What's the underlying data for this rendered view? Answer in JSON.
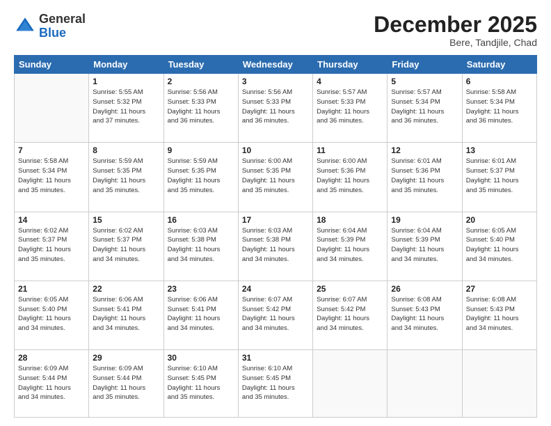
{
  "header": {
    "logo": {
      "general": "General",
      "blue": "Blue"
    },
    "title": "December 2025",
    "location": "Bere, Tandjile, Chad"
  },
  "weekdays": [
    "Sunday",
    "Monday",
    "Tuesday",
    "Wednesday",
    "Thursday",
    "Friday",
    "Saturday"
  ],
  "weeks": [
    [
      {
        "day": null,
        "data": null
      },
      {
        "day": "1",
        "data": "Sunrise: 5:55 AM\nSunset: 5:32 PM\nDaylight: 11 hours\nand 37 minutes."
      },
      {
        "day": "2",
        "data": "Sunrise: 5:56 AM\nSunset: 5:33 PM\nDaylight: 11 hours\nand 36 minutes."
      },
      {
        "day": "3",
        "data": "Sunrise: 5:56 AM\nSunset: 5:33 PM\nDaylight: 11 hours\nand 36 minutes."
      },
      {
        "day": "4",
        "data": "Sunrise: 5:57 AM\nSunset: 5:33 PM\nDaylight: 11 hours\nand 36 minutes."
      },
      {
        "day": "5",
        "data": "Sunrise: 5:57 AM\nSunset: 5:34 PM\nDaylight: 11 hours\nand 36 minutes."
      },
      {
        "day": "6",
        "data": "Sunrise: 5:58 AM\nSunset: 5:34 PM\nDaylight: 11 hours\nand 36 minutes."
      }
    ],
    [
      {
        "day": "7",
        "data": "Sunrise: 5:58 AM\nSunset: 5:34 PM\nDaylight: 11 hours\nand 35 minutes."
      },
      {
        "day": "8",
        "data": "Sunrise: 5:59 AM\nSunset: 5:35 PM\nDaylight: 11 hours\nand 35 minutes."
      },
      {
        "day": "9",
        "data": "Sunrise: 5:59 AM\nSunset: 5:35 PM\nDaylight: 11 hours\nand 35 minutes."
      },
      {
        "day": "10",
        "data": "Sunrise: 6:00 AM\nSunset: 5:35 PM\nDaylight: 11 hours\nand 35 minutes."
      },
      {
        "day": "11",
        "data": "Sunrise: 6:00 AM\nSunset: 5:36 PM\nDaylight: 11 hours\nand 35 minutes."
      },
      {
        "day": "12",
        "data": "Sunrise: 6:01 AM\nSunset: 5:36 PM\nDaylight: 11 hours\nand 35 minutes."
      },
      {
        "day": "13",
        "data": "Sunrise: 6:01 AM\nSunset: 5:37 PM\nDaylight: 11 hours\nand 35 minutes."
      }
    ],
    [
      {
        "day": "14",
        "data": "Sunrise: 6:02 AM\nSunset: 5:37 PM\nDaylight: 11 hours\nand 35 minutes."
      },
      {
        "day": "15",
        "data": "Sunrise: 6:02 AM\nSunset: 5:37 PM\nDaylight: 11 hours\nand 34 minutes."
      },
      {
        "day": "16",
        "data": "Sunrise: 6:03 AM\nSunset: 5:38 PM\nDaylight: 11 hours\nand 34 minutes."
      },
      {
        "day": "17",
        "data": "Sunrise: 6:03 AM\nSunset: 5:38 PM\nDaylight: 11 hours\nand 34 minutes."
      },
      {
        "day": "18",
        "data": "Sunrise: 6:04 AM\nSunset: 5:39 PM\nDaylight: 11 hours\nand 34 minutes."
      },
      {
        "day": "19",
        "data": "Sunrise: 6:04 AM\nSunset: 5:39 PM\nDaylight: 11 hours\nand 34 minutes."
      },
      {
        "day": "20",
        "data": "Sunrise: 6:05 AM\nSunset: 5:40 PM\nDaylight: 11 hours\nand 34 minutes."
      }
    ],
    [
      {
        "day": "21",
        "data": "Sunrise: 6:05 AM\nSunset: 5:40 PM\nDaylight: 11 hours\nand 34 minutes."
      },
      {
        "day": "22",
        "data": "Sunrise: 6:06 AM\nSunset: 5:41 PM\nDaylight: 11 hours\nand 34 minutes."
      },
      {
        "day": "23",
        "data": "Sunrise: 6:06 AM\nSunset: 5:41 PM\nDaylight: 11 hours\nand 34 minutes."
      },
      {
        "day": "24",
        "data": "Sunrise: 6:07 AM\nSunset: 5:42 PM\nDaylight: 11 hours\nand 34 minutes."
      },
      {
        "day": "25",
        "data": "Sunrise: 6:07 AM\nSunset: 5:42 PM\nDaylight: 11 hours\nand 34 minutes."
      },
      {
        "day": "26",
        "data": "Sunrise: 6:08 AM\nSunset: 5:43 PM\nDaylight: 11 hours\nand 34 minutes."
      },
      {
        "day": "27",
        "data": "Sunrise: 6:08 AM\nSunset: 5:43 PM\nDaylight: 11 hours\nand 34 minutes."
      }
    ],
    [
      {
        "day": "28",
        "data": "Sunrise: 6:09 AM\nSunset: 5:44 PM\nDaylight: 11 hours\nand 34 minutes."
      },
      {
        "day": "29",
        "data": "Sunrise: 6:09 AM\nSunset: 5:44 PM\nDaylight: 11 hours\nand 35 minutes."
      },
      {
        "day": "30",
        "data": "Sunrise: 6:10 AM\nSunset: 5:45 PM\nDaylight: 11 hours\nand 35 minutes."
      },
      {
        "day": "31",
        "data": "Sunrise: 6:10 AM\nSunset: 5:45 PM\nDaylight: 11 hours\nand 35 minutes."
      },
      {
        "day": null,
        "data": null
      },
      {
        "day": null,
        "data": null
      },
      {
        "day": null,
        "data": null
      }
    ]
  ]
}
